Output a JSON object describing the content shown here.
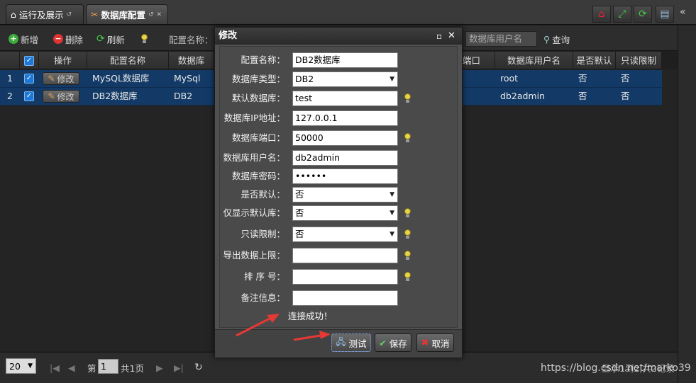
{
  "tabs": [
    {
      "label": "运行及展示",
      "icon": "home-icon",
      "active": false
    },
    {
      "label": "数据库配置",
      "icon": "tools-icon",
      "active": true
    }
  ],
  "toolbar": {
    "add_label": "新增",
    "delete_label": "删除",
    "refresh_label": "刷新",
    "config_name_label": "配置名称：",
    "db_user_placeholder": "数据库用户名",
    "query_label": "查询"
  },
  "grid": {
    "columns": [
      "操作",
      "配置名称",
      "数据库",
      "端口",
      "数据库用户名",
      "是否默认",
      "只读限制"
    ],
    "edit_label": "修改",
    "rows": [
      {
        "index": "1",
        "name": "MySQL数据库",
        "db": "MySql",
        "user": "root",
        "default": "否",
        "readonly": "否"
      },
      {
        "index": "2",
        "name": "DB2数据库",
        "db": "DB2",
        "user": "db2admin",
        "default": "否",
        "readonly": "否"
      }
    ]
  },
  "pager": {
    "page_size": "20",
    "page_prefix": "第",
    "page_value": "1",
    "total_pages": "共1页",
    "summary": "显示1到2,共2记录"
  },
  "watermark": "https://blog.csdn.net/marko39",
  "dialog": {
    "title": "修改",
    "fields": [
      {
        "label": "配置名称：",
        "value": "DB2数据库",
        "type": "text",
        "tip": false
      },
      {
        "label": "数据库类型：",
        "value": "DB2",
        "type": "select",
        "tip": false
      },
      {
        "label": "默认数据库：",
        "value": "test",
        "type": "text",
        "tip": true
      },
      {
        "label": "数据库IP地址：",
        "value": "127.0.0.1",
        "type": "text",
        "tip": false
      },
      {
        "label": "数据库端口：",
        "value": "50000",
        "type": "text",
        "tip": true
      },
      {
        "label": "数据库用户名：",
        "value": "db2admin",
        "type": "text",
        "tip": false
      },
      {
        "label": "数据库密码：",
        "value": "••••••",
        "type": "password",
        "tip": false
      },
      {
        "label": "是否默认：",
        "value": "否",
        "type": "select",
        "tip": false
      },
      {
        "label": "仅显示默认库：",
        "value": "否",
        "type": "select",
        "tip": true
      },
      {
        "label": "只读限制：",
        "value": "否",
        "type": "select",
        "tip": true
      },
      {
        "label": "导出数据上限：",
        "value": "",
        "type": "text",
        "tip": true
      },
      {
        "label": "排 序 号：",
        "value": "",
        "type": "text",
        "tip": true
      },
      {
        "label": "备注信息：",
        "value": "",
        "type": "text",
        "tip": false
      }
    ],
    "status": "连接成功！",
    "test_label": "测试",
    "save_label": "保存",
    "cancel_label": "取消"
  },
  "colors": {
    "selected_row": "#133a66",
    "accent": "#1e78d7",
    "arrow": "#e53935"
  }
}
